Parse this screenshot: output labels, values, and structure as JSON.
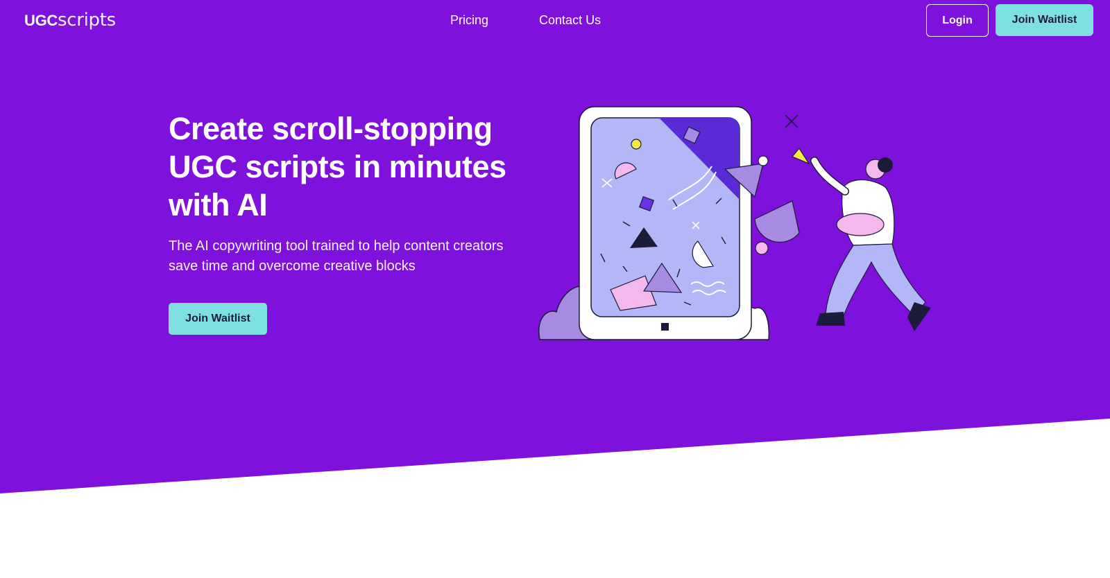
{
  "colors": {
    "hero_background": "#7f11dc",
    "accent_button": "#7ee0e0",
    "button_text": "#1b1b3a",
    "white": "#ffffff"
  },
  "nav": {
    "logo_bold": "UGC",
    "logo_light": "scripts",
    "links": [
      {
        "label": "Pricing"
      },
      {
        "label": "Contact Us"
      }
    ],
    "login_label": "Login",
    "join_label": "Join Waitlist"
  },
  "hero": {
    "title": "Create scroll-stopping UGC scripts in minutes with AI",
    "subtitle": "The AI copywriting tool trained to help content creators save time and overcome creative blocks",
    "cta_label": "Join Waitlist"
  },
  "illustration": {
    "icon": "tablet-with-shapes-and-woman-illustration"
  }
}
